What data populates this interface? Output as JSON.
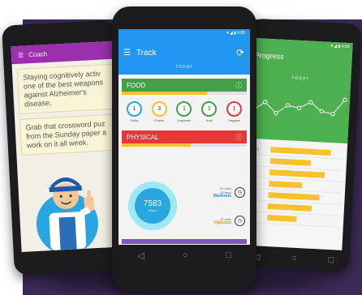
{
  "colors": {
    "background": "#3b2a55",
    "coach": "#9b2fae",
    "track": "#2196f3",
    "food": "#43a047",
    "physical": "#e53935",
    "progress": "#4caf50",
    "bar": "#fbc02d"
  },
  "left_phone": {
    "title": "Coach",
    "menu_icon": "menu-icon",
    "cards": [
      "Staying cognitively activ\none of the best weapons\nagainst Alzheimer's\ndisease.",
      "Grab that crossword puz\nfrom the Sunday paper a\nwork on it all week."
    ],
    "illustration": "thumbs-up-mascot"
  },
  "center_phone": {
    "title": "Track",
    "period": "TODAY",
    "status": "▼◢ ▮ 4:00",
    "sections": {
      "food": {
        "label": "FOOD",
        "progress": 0.68
      },
      "physical": {
        "label": "PHYSICAL",
        "progress": 0.55
      }
    },
    "food_items": [
      {
        "label": "Fruits",
        "value": "1",
        "color": "#29a6df"
      },
      {
        "label": "Grains",
        "value": "3",
        "color": "#fbc02d"
      },
      {
        "label": "Legumes",
        "value": "1",
        "color": "#43a047"
      },
      {
        "label": "Nuts",
        "value": "1",
        "color": "#43a047"
      },
      {
        "label": "Veggies",
        "value": "1",
        "color": "#e53935"
      }
    ],
    "steps": {
      "value": "7583",
      "unit": "steps"
    },
    "activities": [
      {
        "detail": "20 mins\n20 secs",
        "kind": "Moderate",
        "color": "#2196f3"
      },
      {
        "detail": "12 mins",
        "kind": "Vigorous",
        "color": "#fb8c00"
      }
    ]
  },
  "right_phone": {
    "title": "Progress",
    "period": "TODAY",
    "status": "▼◢ ▮ 4:00",
    "line_values": [
      0.55,
      0.35,
      0.6,
      0.4,
      0.45,
      0.3,
      0.5,
      0.55,
      0.2
    ],
    "bar_rows": [
      {
        "label": "FOOD",
        "fraction": 0.82
      },
      {
        "label": "",
        "fraction": 0.55
      },
      {
        "label": "",
        "fraction": 0.75
      },
      {
        "label": "",
        "fraction": 0.45
      },
      {
        "label": "",
        "fraction": 0.7
      },
      {
        "label": "",
        "fraction": 0.6
      },
      {
        "label": "",
        "fraction": 0.4
      }
    ]
  }
}
